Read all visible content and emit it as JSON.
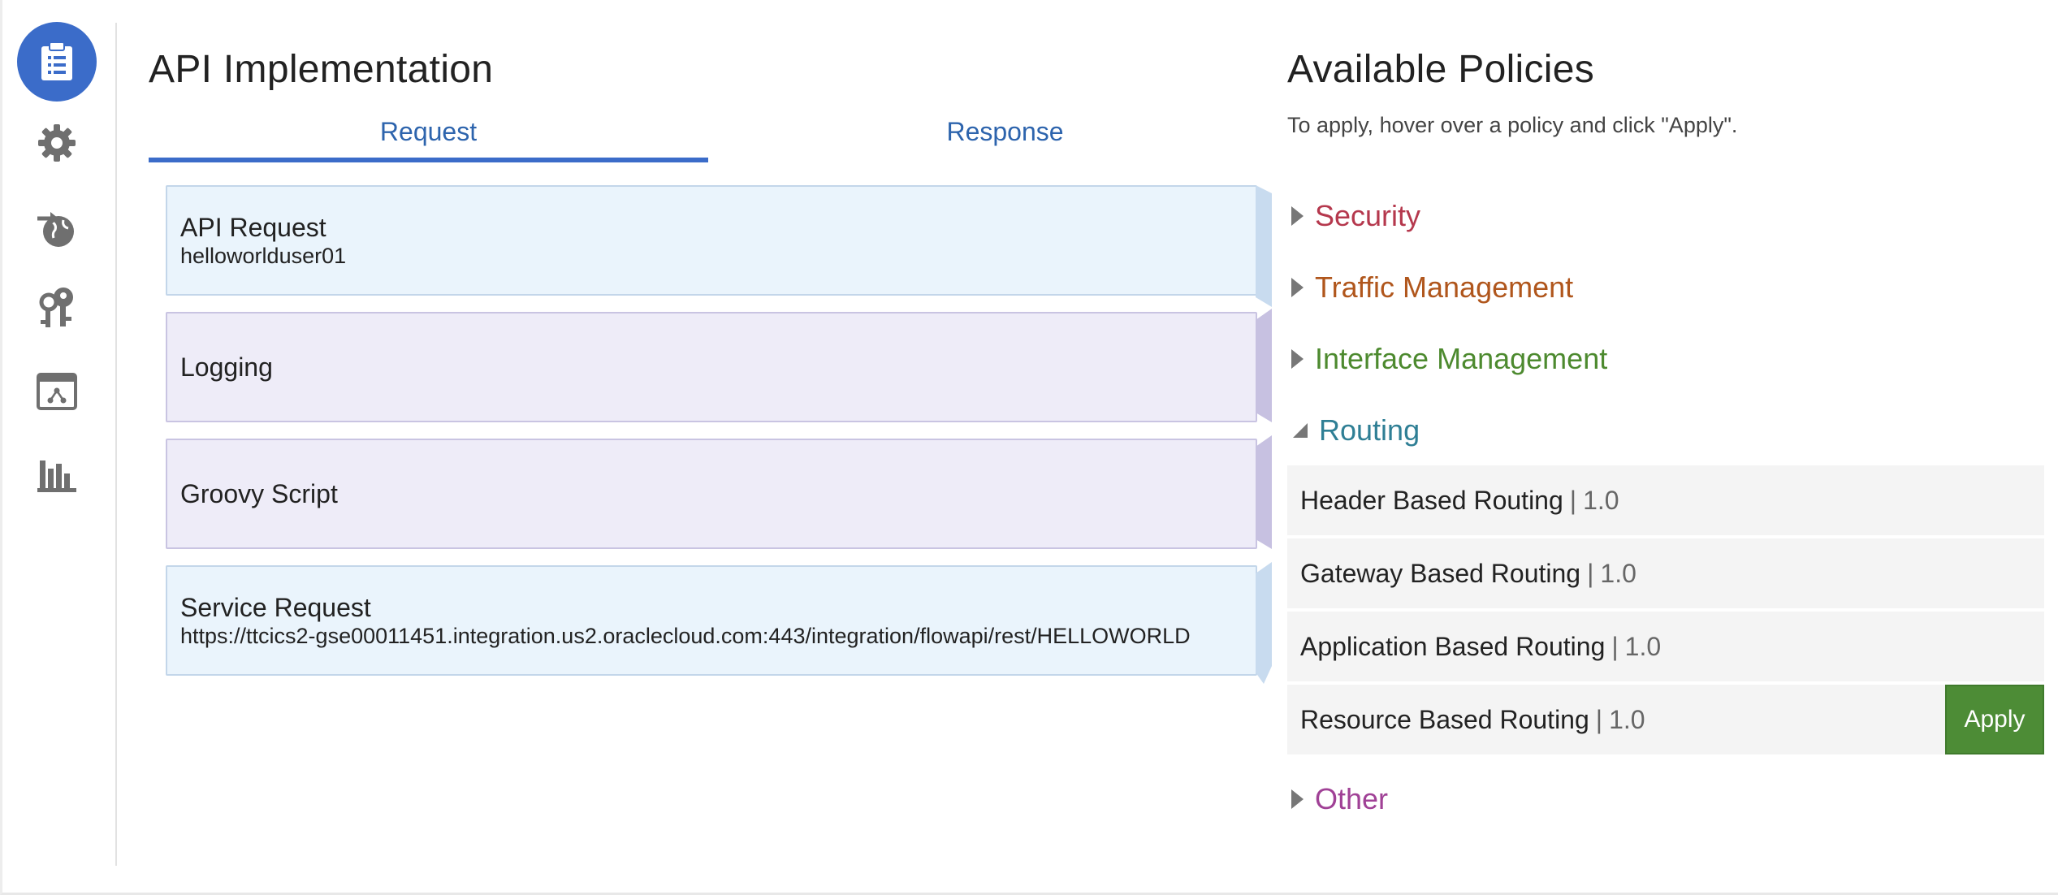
{
  "nav": {
    "items": [
      {
        "icon": "clipboard-list-icon",
        "active": true
      },
      {
        "icon": "gear-icon",
        "active": false
      },
      {
        "icon": "globe-arrow-icon",
        "active": false
      },
      {
        "icon": "keys-icon",
        "active": false
      },
      {
        "icon": "app-network-icon",
        "active": false
      },
      {
        "icon": "bar-chart-icon",
        "active": false
      }
    ],
    "active_color": "#3b6cc9",
    "icon_color": "#6f6f6f"
  },
  "implementation": {
    "title": "API Implementation",
    "tabs": [
      {
        "label": "Request",
        "active": true
      },
      {
        "label": "Response",
        "active": false
      }
    ],
    "cards": [
      {
        "title": "API Request",
        "subtitle": "helloworlduser01",
        "style": "blue"
      },
      {
        "title": "Logging",
        "subtitle": "",
        "style": "purple"
      },
      {
        "title": "Groovy Script",
        "subtitle": "",
        "style": "purple"
      },
      {
        "title": "Service Request",
        "subtitle": "https://ttcics2-gse00011451.integration.us2.oraclecloud.com:443/integration/flowapi/rest/HELLOWORLD",
        "style": "blue"
      }
    ]
  },
  "policies": {
    "title": "Available Policies",
    "hint": "To apply, hover over a policy and click \"Apply\".",
    "categories": [
      {
        "label": "Security",
        "color": "#b5384d",
        "expanded": false
      },
      {
        "label": "Traffic Management",
        "color": "#b0561c",
        "expanded": false
      },
      {
        "label": "Interface Management",
        "color": "#4d8a2f",
        "expanded": false
      },
      {
        "label": "Routing",
        "color": "#2f7f95",
        "expanded": true
      },
      {
        "label": "Other",
        "color": "#a04196",
        "expanded": false
      }
    ],
    "routing_items": [
      {
        "name": "Header Based Routing",
        "separator": "|",
        "version": "1.0"
      },
      {
        "name": "Gateway Based Routing",
        "separator": "|",
        "version": "1.0"
      },
      {
        "name": "Application Based Routing",
        "separator": "|",
        "version": "1.0"
      },
      {
        "name": "Resource Based Routing",
        "separator": "|",
        "version": "1.0"
      }
    ],
    "apply_label": "Apply",
    "apply_color": "#4d8c36"
  }
}
